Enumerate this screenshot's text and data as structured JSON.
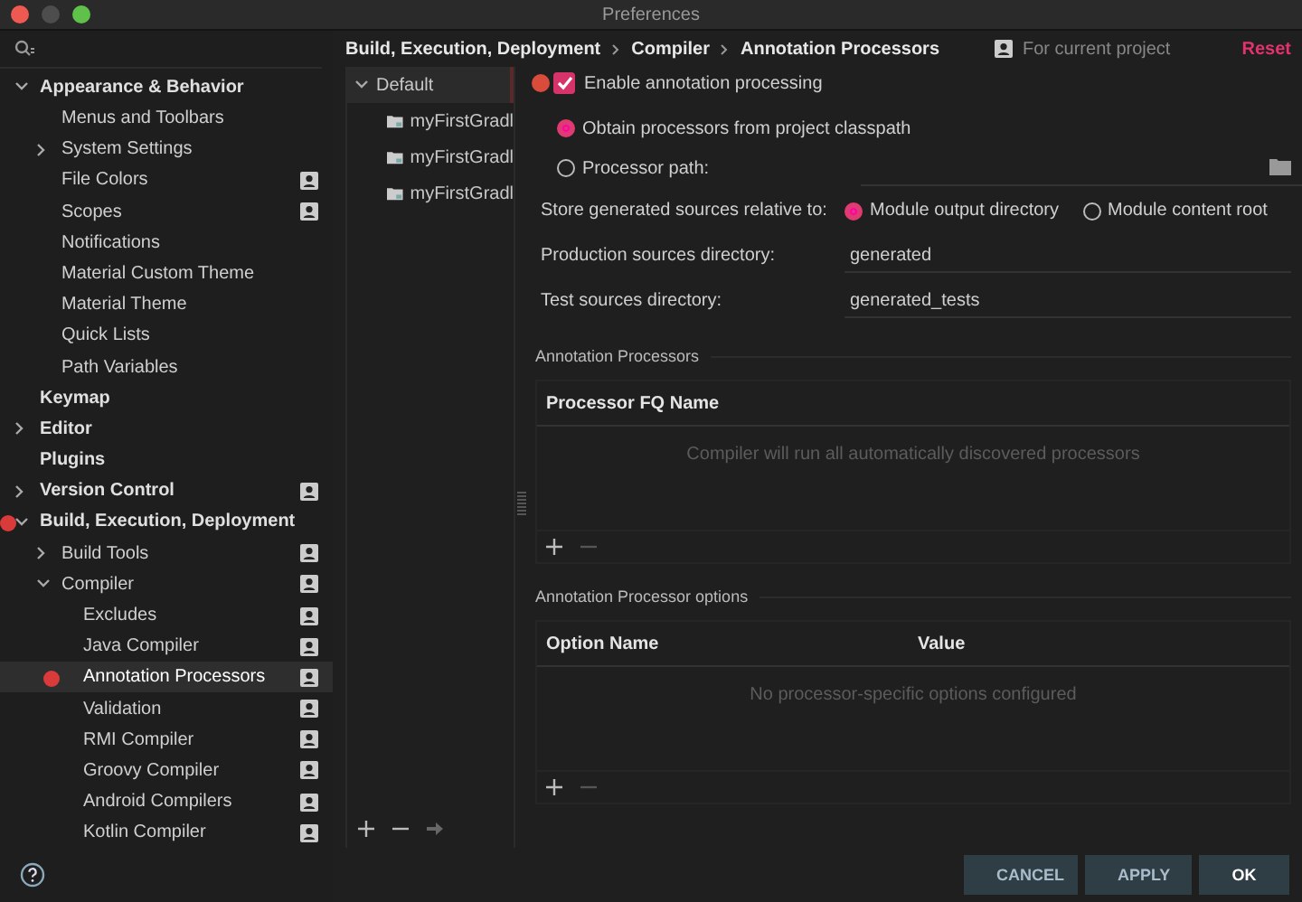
{
  "window": {
    "title": "Preferences"
  },
  "sidebar": {
    "items": [
      {
        "label": "Appearance & Behavior",
        "bold": true,
        "expanded": true,
        "children": [
          {
            "label": "Menus and Toolbars",
            "project": false,
            "selected": false,
            "marked": false
          },
          {
            "label": "System Settings",
            "expanded": false,
            "project": false,
            "selected": false,
            "marked": false
          },
          {
            "label": "File Colors",
            "project": true,
            "selected": false,
            "marked": false
          },
          {
            "label": "Scopes",
            "project": true,
            "selected": false,
            "marked": false
          },
          {
            "label": "Notifications",
            "project": false,
            "selected": false,
            "marked": false
          },
          {
            "label": "Material Custom Theme",
            "project": false,
            "selected": false,
            "marked": false
          },
          {
            "label": "Material Theme",
            "project": false,
            "selected": false,
            "marked": false
          },
          {
            "label": "Quick Lists",
            "project": false,
            "selected": false,
            "marked": false
          },
          {
            "label": "Path Variables",
            "project": false,
            "selected": false,
            "marked": false
          }
        ],
        "project": false,
        "selected": false,
        "marked": false
      },
      {
        "label": "Keymap",
        "bold": true,
        "project": false,
        "selected": false,
        "marked": false
      },
      {
        "label": "Editor",
        "bold": true,
        "expanded": false,
        "project": false,
        "selected": false,
        "marked": false
      },
      {
        "label": "Plugins",
        "bold": true,
        "project": false,
        "selected": false,
        "marked": false
      },
      {
        "label": "Version Control",
        "bold": true,
        "expanded": false,
        "project": true,
        "selected": false,
        "marked": false
      },
      {
        "label": "Build, Execution, Deployment",
        "bold": true,
        "expanded": true,
        "project": false,
        "selected": false,
        "marked": true,
        "children": [
          {
            "label": "Build Tools",
            "expanded": false,
            "project": true,
            "selected": false,
            "marked": false
          },
          {
            "label": "Compiler",
            "expanded": true,
            "project": true,
            "selected": false,
            "marked": false,
            "children": [
              {
                "label": "Excludes",
                "project": true,
                "selected": false,
                "marked": false
              },
              {
                "label": "Java Compiler",
                "project": true,
                "selected": false,
                "marked": false
              },
              {
                "label": "Annotation Processors",
                "project": true,
                "selected": true,
                "marked": true
              },
              {
                "label": "Validation",
                "project": true,
                "selected": false,
                "marked": false
              },
              {
                "label": "RMI Compiler",
                "project": true,
                "selected": false,
                "marked": false
              },
              {
                "label": "Groovy Compiler",
                "project": true,
                "selected": false,
                "marked": false
              },
              {
                "label": "Android Compilers",
                "project": true,
                "selected": false,
                "marked": false
              },
              {
                "label": "Kotlin Compiler",
                "project": true,
                "selected": false,
                "marked": false
              }
            ]
          }
        ]
      }
    ]
  },
  "breadcrumb": [
    "Build, Execution, Deployment",
    "Compiler",
    "Annotation Processors"
  ],
  "scope_label": "For current project",
  "reset": "Reset",
  "profiles": [
    {
      "label": "Default",
      "expanded": true,
      "selected": true,
      "children": [
        {
          "label": "myFirstGradl",
          "selected": false
        },
        {
          "label": "myFirstGradl",
          "selected": false
        },
        {
          "label": "myFirstGradl",
          "selected": false
        }
      ]
    }
  ],
  "enable": {
    "label": "Enable annotation processing",
    "checked": true,
    "marked": true
  },
  "source_options": [
    {
      "label": "Obtain processors from project classpath",
      "selected": true
    },
    {
      "label": "Processor path:",
      "selected": false
    }
  ],
  "store_relative": {
    "label": "Store generated sources relative to:",
    "options": [
      {
        "label": "Module output directory",
        "selected": true
      },
      {
        "label": "Module content root",
        "selected": false
      }
    ]
  },
  "fields": [
    {
      "label": "Production sources directory:",
      "value": "generated"
    },
    {
      "label": "Test sources directory:",
      "value": "generated_tests"
    }
  ],
  "processors": {
    "title": "Annotation Processors",
    "columns": [
      "Processor FQ Name"
    ],
    "empty": "Compiler will run all automatically discovered processors"
  },
  "options": {
    "title": "Annotation Processor options",
    "columns": [
      "Option Name",
      "Value"
    ],
    "empty": "No processor-specific options configured"
  },
  "buttons": [
    {
      "label": "CANCEL",
      "default": false
    },
    {
      "label": "APPLY",
      "default": false
    },
    {
      "label": "OK",
      "default": true
    }
  ]
}
